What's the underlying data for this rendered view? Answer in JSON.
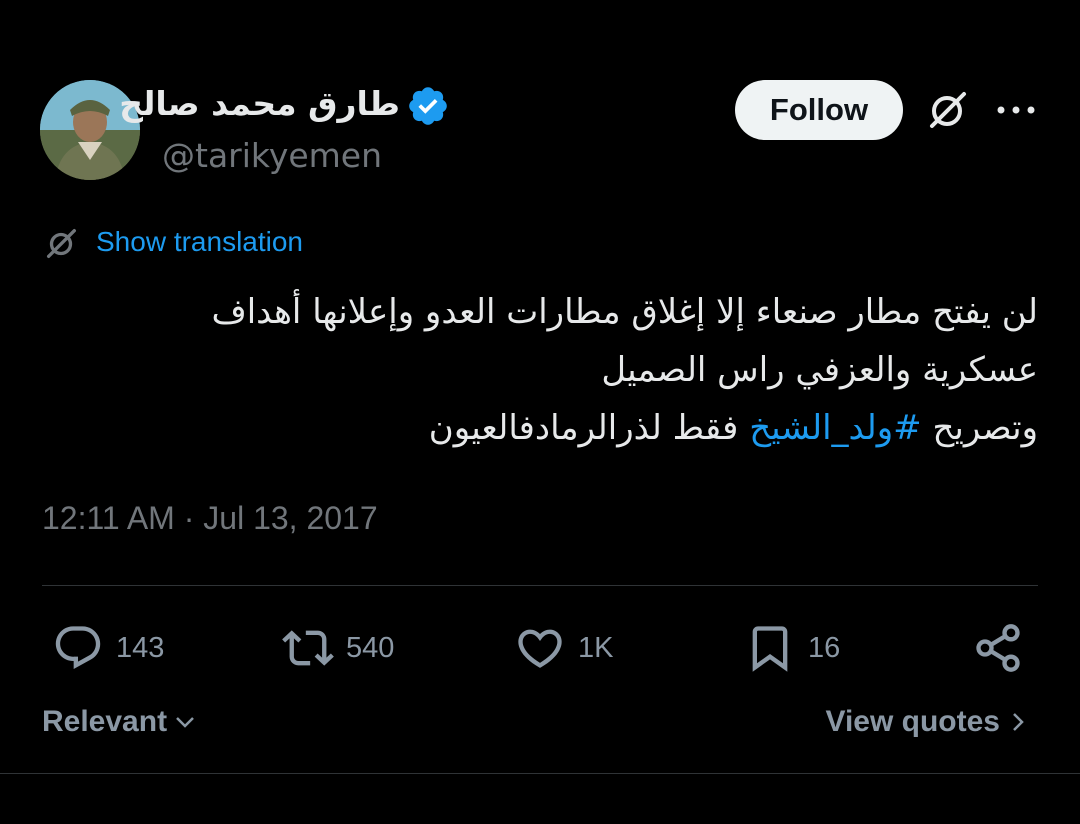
{
  "author": {
    "display_name": "طارق محمد صالح",
    "handle": "@tarikyemen",
    "verified": true
  },
  "header": {
    "follow_label": "Follow",
    "icons": [
      "grok-icon",
      "more-icon"
    ]
  },
  "translation": {
    "label": "Show translation"
  },
  "tweet": {
    "line1": "لن يفتح مطار صنعاء إلا إغلاق  مطارات العدو وإعلانها أهداف",
    "line2": "عسكرية والعزفي راس الصميل",
    "line3_prefix": "وتصريح ",
    "hashtag": "#ولد_الشيخ",
    "line3_suffix": " فقط لذرالرمادفالعيون"
  },
  "timestamp": "12:11 AM · Jul 13, 2017",
  "actions": {
    "replies": "143",
    "retweets": "540",
    "likes": "1K",
    "bookmarks": "16"
  },
  "footer": {
    "sort_label": "Relevant",
    "view_quotes_label": "View quotes"
  },
  "colors": {
    "background": "#000000",
    "text": "#e7e9ea",
    "muted": "#71767b",
    "link": "#1d9bf0",
    "verified": "#1d9bf0"
  }
}
